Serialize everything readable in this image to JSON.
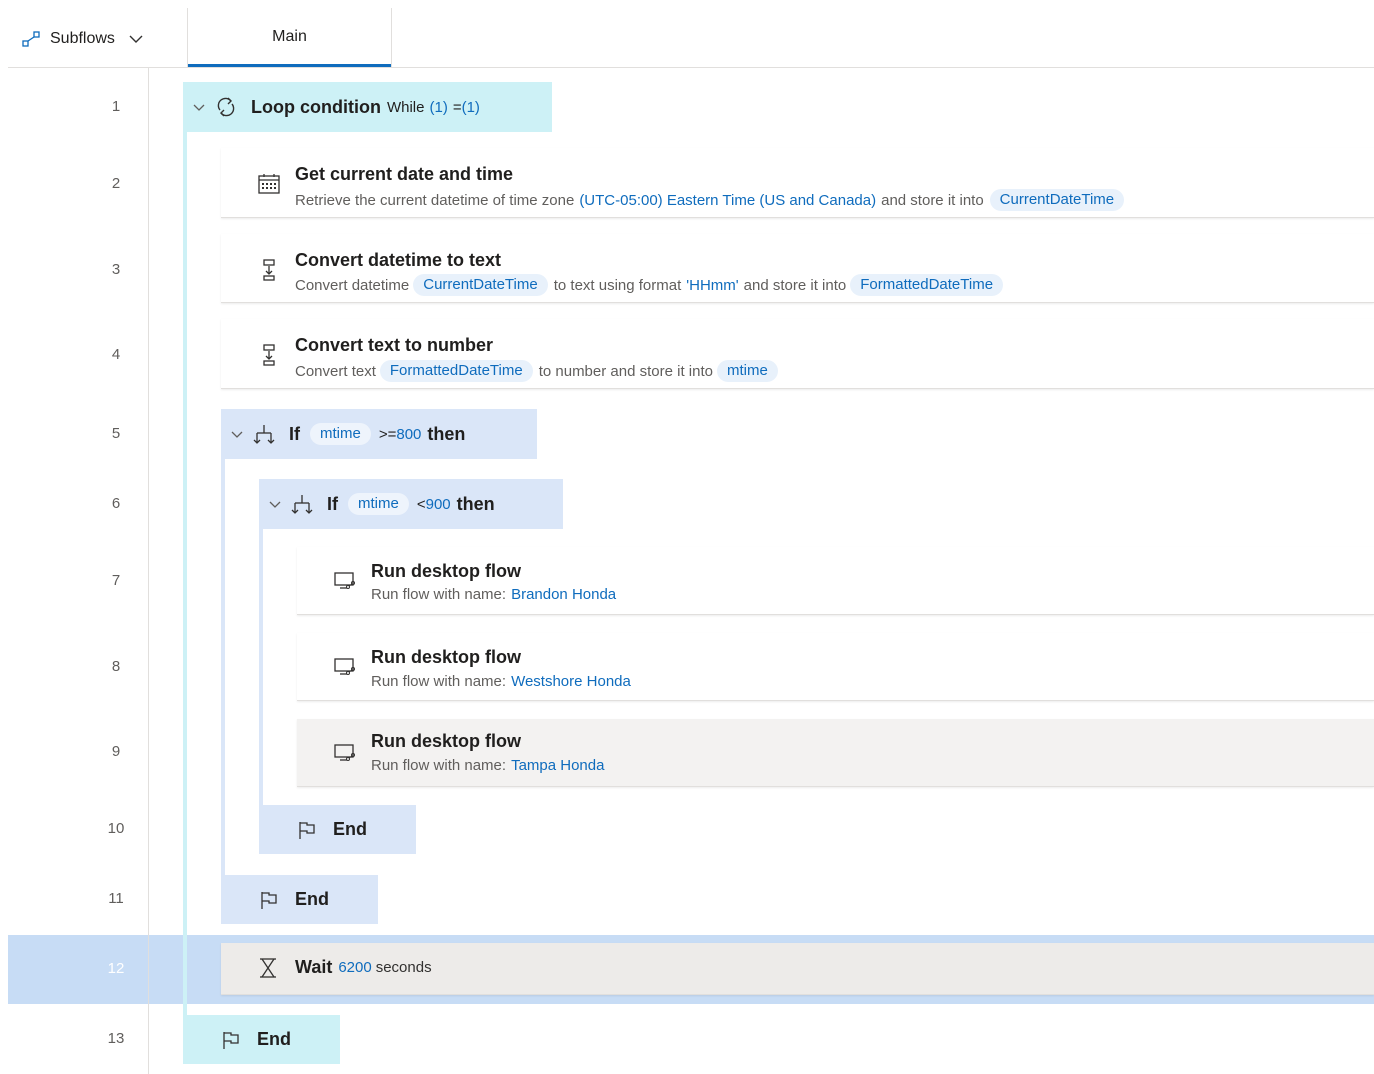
{
  "tabs": {
    "subflows_label": "Subflows",
    "main_label": "Main"
  },
  "line_numbers": [
    "1",
    "2",
    "3",
    "4",
    "5",
    "6",
    "7",
    "8",
    "9",
    "10",
    "11",
    "12",
    "13"
  ],
  "steps": {
    "loop": {
      "title": "Loop condition",
      "while_word": "While",
      "lhs": "(1)",
      "op": "=",
      "rhs": "(1)"
    },
    "get_date": {
      "title": "Get current date and time",
      "desc_prefix": "Retrieve the current datetime of time zone",
      "timezone": "(UTC-05:00) Eastern Time (US and Canada)",
      "desc_mid": "and store it into",
      "var": "CurrentDateTime"
    },
    "dt_to_text": {
      "title": "Convert datetime to text",
      "desc_prefix": "Convert datetime",
      "var_in": "CurrentDateTime",
      "desc_mid": "to text using format",
      "format": "'HHmm'",
      "desc_mid2": "and store it into",
      "var_out": "FormattedDateTime"
    },
    "text_to_num": {
      "title": "Convert text to number",
      "desc_prefix": "Convert text",
      "var_in": "FormattedDateTime",
      "desc_mid": "to number and store it into",
      "var_out": "mtime"
    },
    "if1": {
      "if_word": "If",
      "var": "mtime",
      "op": ">=",
      "value": "800",
      "then_word": "then"
    },
    "if2": {
      "if_word": "If",
      "var": "mtime",
      "op": "<",
      "value": "900",
      "then_word": "then"
    },
    "run1": {
      "title": "Run desktop flow",
      "desc_prefix": "Run flow with name:",
      "flow": "Brandon Honda"
    },
    "run2": {
      "title": "Run desktop flow",
      "desc_prefix": "Run flow with name:",
      "flow": "Westshore Honda"
    },
    "run3": {
      "title": "Run desktop flow",
      "desc_prefix": "Run flow with name:",
      "flow": "Tampa Honda"
    },
    "end_inner": "End",
    "end_outer": "End",
    "wait": {
      "word": "Wait",
      "value": "6200",
      "unit": "seconds"
    },
    "end_loop": "End"
  },
  "colors": {
    "accent": "#0f6cbd",
    "loop_bg": "#cdf1f6",
    "if_bg": "#dae6f8",
    "selected_row": "#c7dcf5"
  }
}
